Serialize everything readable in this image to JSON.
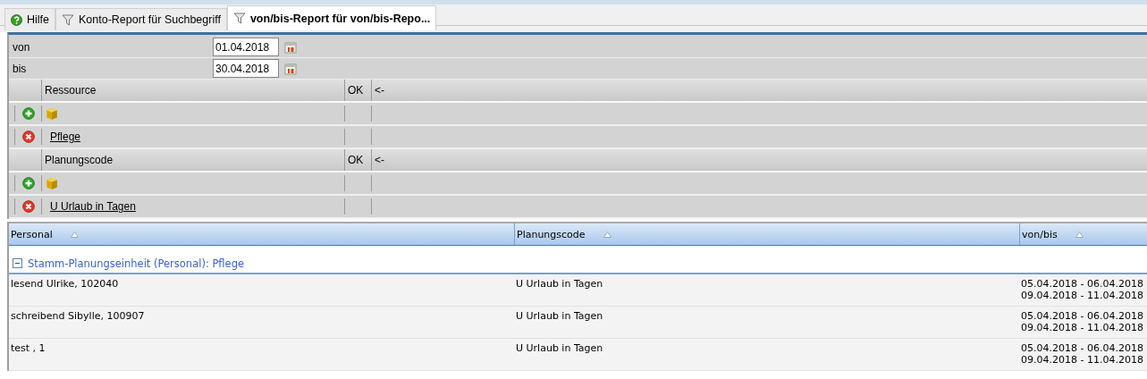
{
  "tabs": [
    {
      "label": "Hilfe",
      "kind": "help",
      "selected": false
    },
    {
      "label": "Konto-Report für Suchbegriff",
      "kind": "report",
      "selected": false
    },
    {
      "label": "von/bis-Report für von/bis-Repo...",
      "kind": "report",
      "selected": true
    }
  ],
  "date_fields": [
    {
      "label": "von",
      "value": "01.04.2018"
    },
    {
      "label": "bis",
      "value": "30.04.2018"
    }
  ],
  "selection_lists": [
    {
      "header": "Ressource",
      "ok_label": "OK",
      "back_label": "<-",
      "entries": [
        {
          "kind": "add"
        },
        {
          "kind": "remove",
          "text": "Pflege"
        }
      ]
    },
    {
      "header": "Planungscode",
      "ok_label": "OK",
      "back_label": "<-",
      "entries": [
        {
          "kind": "add"
        },
        {
          "kind": "remove",
          "text": "U Urlaub in Tagen"
        }
      ]
    }
  ],
  "grid": {
    "columns": [
      {
        "label": "Personal"
      },
      {
        "label": "Planungscode"
      },
      {
        "label": "von/bis"
      }
    ],
    "group": {
      "label": "Stamm-Planungseinheit (Personal): Pflege",
      "expanded": true
    },
    "rows": [
      {
        "personal": "lesend Ulrike, 102040",
        "code": "U Urlaub in Tagen",
        "periods": [
          "05.04.2018 - 06.04.2018",
          "09.04.2018 - 11.04.2018"
        ]
      },
      {
        "personal": "schreibend Sibylle, 100907",
        "code": "U Urlaub in Tagen",
        "periods": [
          "05.04.2018 - 06.04.2018",
          "09.04.2018 - 11.04.2018"
        ]
      },
      {
        "personal": "test , 1",
        "code": "U Urlaub in Tagen",
        "periods": [
          "05.04.2018 - 06.04.2018",
          "09.04.2018 - 11.04.2018"
        ]
      }
    ]
  }
}
